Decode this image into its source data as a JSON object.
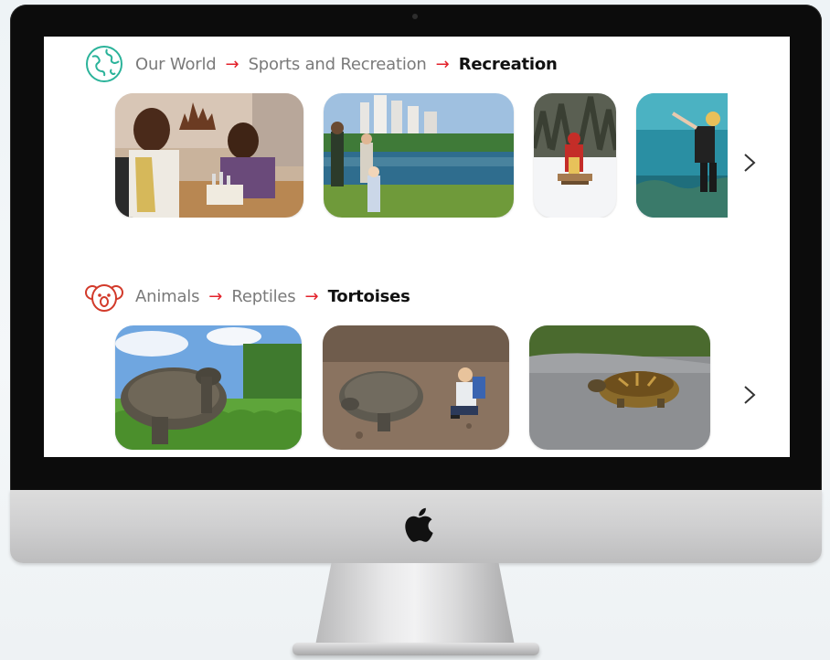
{
  "sections": [
    {
      "icon": "globe-icon",
      "accent": "#2bb39a",
      "breadcrumb": [
        "Our World",
        "Sports and Recreation",
        "Recreation"
      ],
      "images": [
        "men-playing-chess-photo",
        "kids-by-lake-photo",
        "child-on-sled-photo",
        "scuba-diver-photo"
      ]
    },
    {
      "icon": "koala-icon",
      "accent": "#d23a2a",
      "breadcrumb": [
        "Animals",
        "Reptiles",
        "Tortoises"
      ],
      "images": [
        "giant-tortoise-grass-photo",
        "boy-with-tortoise-photo",
        "tortoise-on-road-photo"
      ]
    }
  ],
  "separator": "→",
  "colors": {
    "arrow": "#e3222b",
    "crumb": "#7a7a7a",
    "current": "#111111"
  }
}
